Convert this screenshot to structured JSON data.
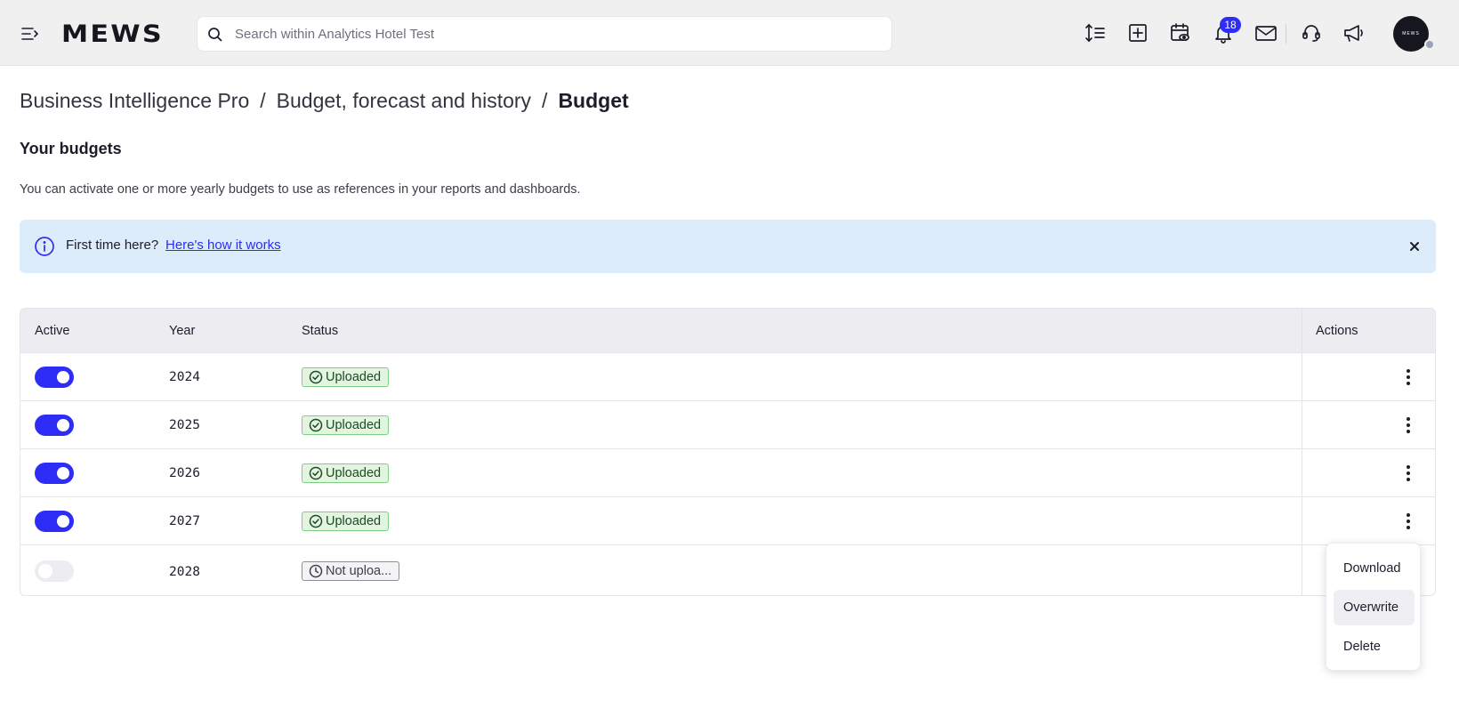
{
  "topbar": {
    "logo": "MEWS",
    "search_placeholder": "Search within Analytics Hotel Test",
    "notification_count": "18",
    "avatar_text": "MEWS",
    "icons": [
      "menu-icon",
      "search-icon",
      "sort-lines-icon",
      "add-square-icon",
      "calendar-view-icon",
      "bell-icon",
      "mail-icon",
      "headset-icon",
      "megaphone-icon"
    ]
  },
  "breadcrumb": {
    "items": [
      "Business Intelligence Pro",
      "Budget, forecast and history"
    ],
    "current": "Budget"
  },
  "section": {
    "title": "Your budgets",
    "description": "You can activate one or more yearly budgets to use as references in your reports and dashboards."
  },
  "banner": {
    "lead": "First time here?",
    "link": "Here's how it works"
  },
  "table": {
    "headers": {
      "active": "Active",
      "year": "Year",
      "status": "Status",
      "actions": "Actions"
    },
    "rows": [
      {
        "active": true,
        "year": "2024",
        "status": "Uploaded"
      },
      {
        "active": true,
        "year": "2025",
        "status": "Uploaded"
      },
      {
        "active": true,
        "year": "2026",
        "status": "Uploaded"
      },
      {
        "active": true,
        "year": "2027",
        "status": "Uploaded"
      },
      {
        "active": false,
        "year": "2028",
        "status": "Not uploa..."
      }
    ]
  },
  "menu": {
    "items": [
      "Download",
      "Overwrite",
      "Delete"
    ],
    "highlighted": "Overwrite"
  },
  "colors": {
    "accent": "#2d2df5",
    "banner_bg": "#ddecfb",
    "uploaded_bg": "#e3f5e1",
    "uploaded_border": "#7fcf82"
  }
}
